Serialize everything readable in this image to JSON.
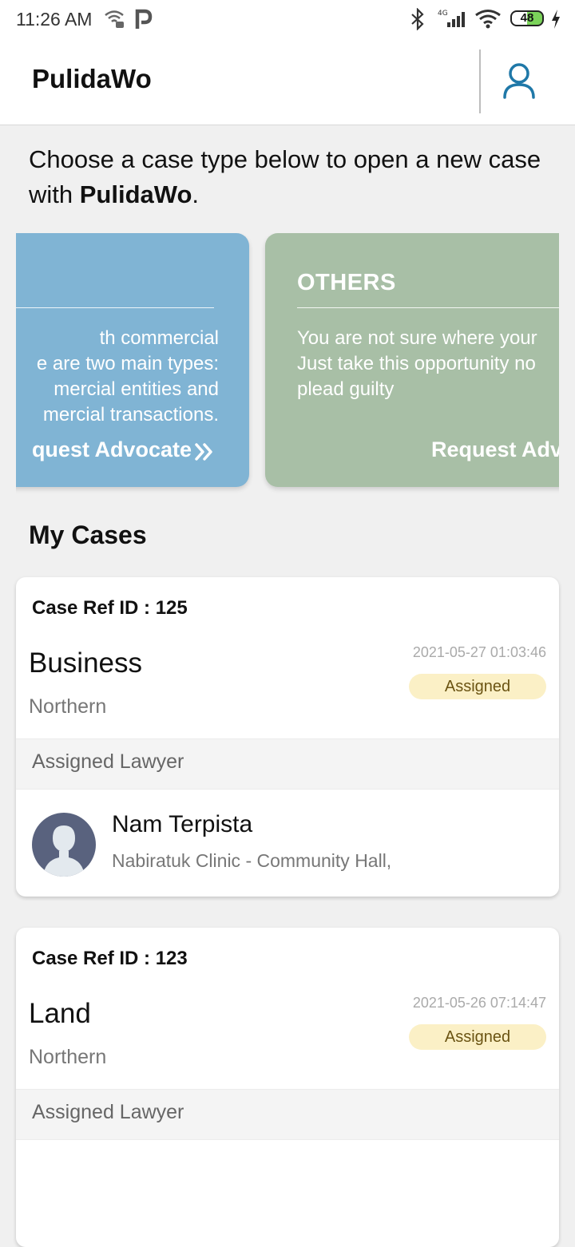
{
  "status_bar": {
    "time": "11:26 AM",
    "network": "4G",
    "battery": "48",
    "icons": [
      "wifi-calling-icon",
      "parking-icon",
      "bluetooth-icon",
      "signal-icon",
      "wifi-icon",
      "battery-icon",
      "charging-icon"
    ]
  },
  "header": {
    "title": "PulidaWo",
    "profile_icon": "user-icon"
  },
  "intro": {
    "text_before": "Choose a case type below to open a new case with ",
    "brand": "PulidaWo",
    "text_after": "."
  },
  "case_types": [
    {
      "title": "",
      "description_lines": [
        "th commercial",
        "e are two main types:",
        "mercial entities and",
        "mercial transactions."
      ],
      "link": "quest Advocate",
      "color": "#80b4d4"
    },
    {
      "title": "OTHERS",
      "description_lines": [
        "You are not sure where your",
        "Just take this opportunity no",
        "plead guilty"
      ],
      "link": "Request Adv",
      "color": "#a8bfa6"
    }
  ],
  "my_cases": {
    "title": "My Cases",
    "lawyer_section_label": "Assigned Lawyer",
    "cases": [
      {
        "ref": "Case Ref ID : 125",
        "type": "Business",
        "region": "Northern",
        "date": "2021-05-27 01:03:46",
        "status": "Assigned",
        "lawyer_name": "Nam Terpista",
        "lawyer_address": "Nabiratuk Clinic - Community Hall,"
      },
      {
        "ref": "Case Ref ID : 123",
        "type": "Land",
        "region": "Northern",
        "date": "2021-05-26 07:14:47",
        "status": "Assigned"
      }
    ]
  },
  "colors": {
    "accent": "#1f78a8",
    "status_bg": "#fbf0c6",
    "avatar_bg": "#59627e"
  }
}
